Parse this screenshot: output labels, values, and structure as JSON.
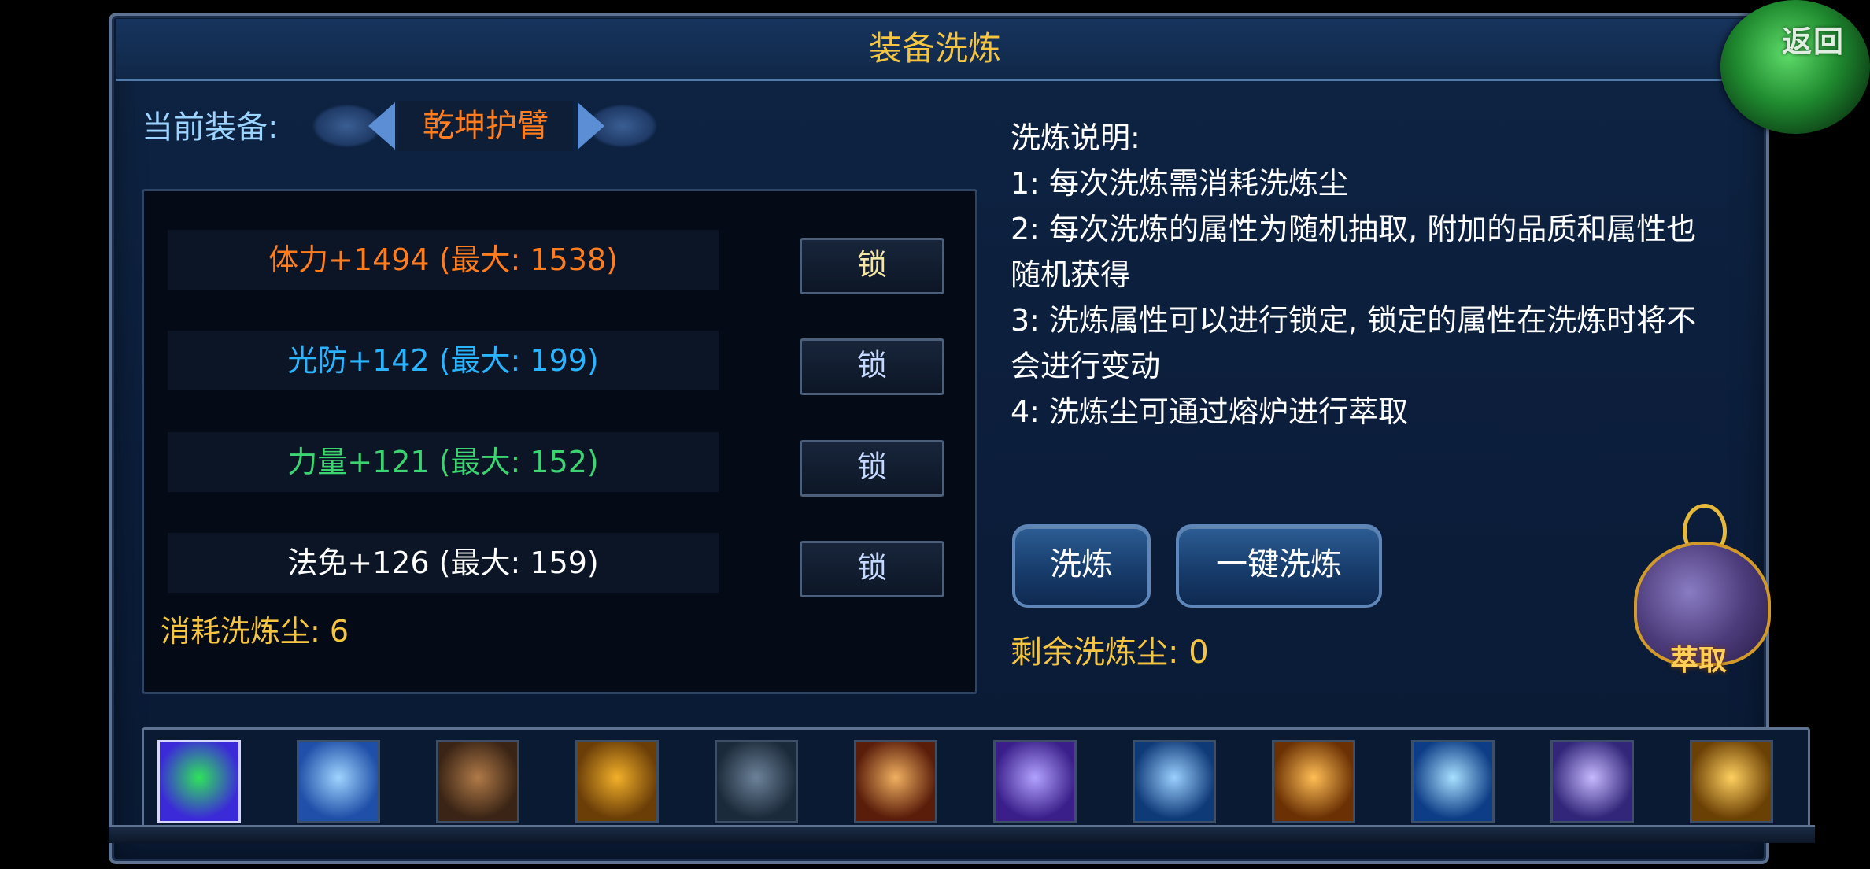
{
  "title": "装备洗炼",
  "return_label": "返回",
  "current_equip_label": "当前装备:",
  "equip_name": "乾坤护臂",
  "attributes": [
    {
      "text": "体力+1494  (最大: 1538)",
      "color": "#ff7d1e",
      "lock": "锁",
      "lock_color": "#f5e6a8"
    },
    {
      "text": "光防+142  (最大: 199)",
      "color": "#2ab4ff",
      "lock": "锁",
      "lock_color": "#c5d8ff"
    },
    {
      "text": "力量+121  (最大: 152)",
      "color": "#3cd470",
      "lock": "锁",
      "lock_color": "#c5d8ff"
    },
    {
      "text": "法免+126  (最大: 159)",
      "color": "#ffffff",
      "lock": "锁",
      "lock_color": "#c5d8ff"
    }
  ],
  "cost_label": "消耗洗炼尘: 6",
  "description": {
    "heading": "洗炼说明:",
    "lines": [
      "1: 每次洗炼需消耗洗炼尘",
      "2: 每次洗炼的属性为随机抽取, 附加的品质和属性也",
      "随机获得",
      "3: 洗炼属性可以进行锁定, 锁定的属性在洗炼时将不",
      "会进行变动",
      "4: 洗炼尘可通过熔炉进行萃取"
    ]
  },
  "buttons": {
    "wash": "洗炼",
    "wash_all": "一键洗炼"
  },
  "remain_label": "剩余洗炼尘: 0",
  "extract_label": "萃取",
  "skills": [
    {
      "icon": "jade-sword-icon",
      "c1": "#3b2ad8",
      "c2": "#2fe35b"
    },
    {
      "icon": "lightning-icon",
      "c1": "#1f4fa8",
      "c2": "#9fd4ff"
    },
    {
      "icon": "armor-icon",
      "c1": "#3a2415",
      "c2": "#b07a48"
    },
    {
      "icon": "shield-icon",
      "c1": "#6b3e08",
      "c2": "#f2b029"
    },
    {
      "icon": "silhouette-icon",
      "c1": "#1b2a3a",
      "c2": "#6d8299"
    },
    {
      "icon": "flame-slash-icon",
      "c1": "#5a1d0a",
      "c2": "#f0b060"
    },
    {
      "icon": "blade-icon",
      "c1": "#3a1f8a",
      "c2": "#b2a2ff"
    },
    {
      "icon": "crescent-icon",
      "c1": "#0f3a78",
      "c2": "#9bd0ff"
    },
    {
      "icon": "golden-figure-icon",
      "c1": "#6b3104",
      "c2": "#ffbe55"
    },
    {
      "icon": "ice-figure-icon",
      "c1": "#0d3d86",
      "c2": "#a8e0ff"
    },
    {
      "icon": "strike-icon",
      "c1": "#32267a",
      "c2": "#c7b9ff"
    },
    {
      "icon": "meditate-icon",
      "c1": "#6b4004",
      "c2": "#ffd060"
    }
  ]
}
